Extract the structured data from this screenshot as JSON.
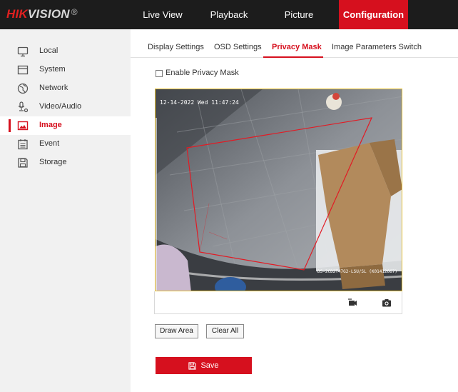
{
  "brand": {
    "part1": "HIK",
    "part2": "VISION",
    "mark": "®"
  },
  "nav": [
    "Live View",
    "Playback",
    "Picture",
    "Configuration"
  ],
  "nav_active": "Configuration",
  "sidebar": {
    "items": [
      {
        "label": "Local",
        "icon": "monitor-icon"
      },
      {
        "label": "System",
        "icon": "system-icon"
      },
      {
        "label": "Network",
        "icon": "globe-icon"
      },
      {
        "label": "Video/Audio",
        "icon": "video-audio-icon"
      },
      {
        "label": "Image",
        "icon": "image-icon"
      },
      {
        "label": "Event",
        "icon": "calendar-icon"
      },
      {
        "label": "Storage",
        "icon": "storage-icon"
      }
    ],
    "active": "Image"
  },
  "subtabs": [
    "Display Settings",
    "OSD Settings",
    "Privacy Mask",
    "Image Parameters Switch"
  ],
  "subtab_active": "Privacy Mask",
  "enable_label": "Enable Privacy Mask",
  "enable_checked": false,
  "video": {
    "osd_datetime": "12-14-2022 Wed 11:47:24",
    "osd_device": "DS-2CD2T47G2-LSU/SL (K01412667)"
  },
  "video_controls": {
    "record_icon": "record-icon",
    "capture_icon": "camera-icon"
  },
  "buttons": {
    "draw_area": "Draw Area",
    "clear_all": "Clear All",
    "save": "Save"
  },
  "colors": {
    "accent": "#d6101e",
    "topbar": "#1c1c1c",
    "sidebar": "#f1f1f1",
    "video_border": "#e8c232",
    "mask_line": "#e21b24"
  }
}
